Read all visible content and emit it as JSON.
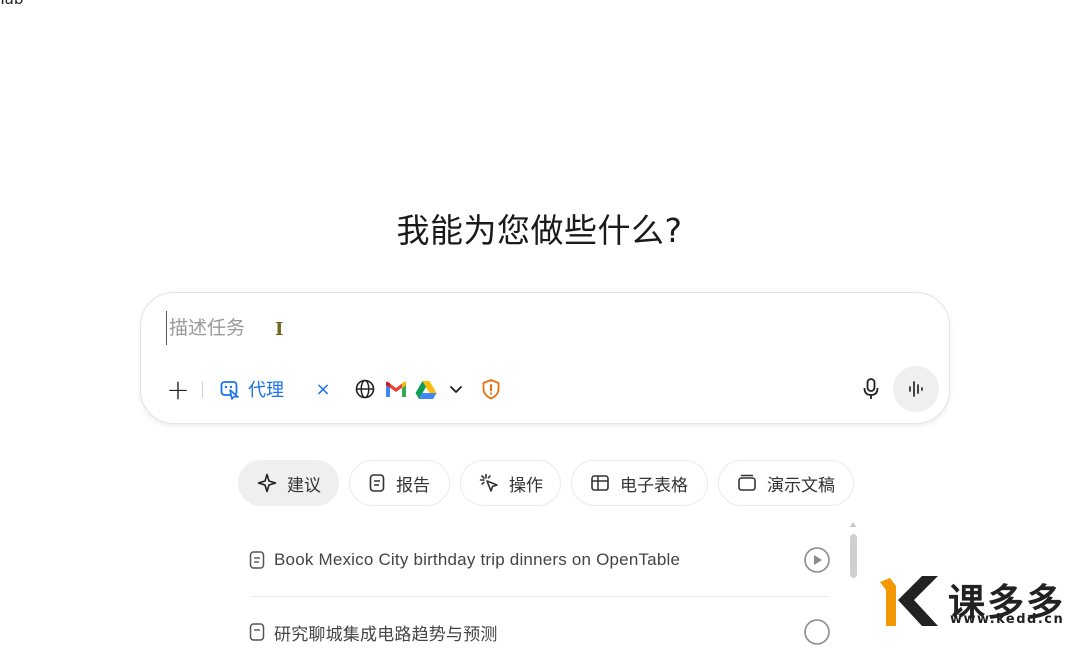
{
  "corner_text": "Tab",
  "heading": "我能为您做些什么?",
  "composer": {
    "placeholder": "描述任务",
    "agent_label": "代理",
    "agent_remove": "×",
    "plus": "+"
  },
  "tabs": [
    {
      "label": "建议",
      "icon": "sparkle-icon",
      "active": true
    },
    {
      "label": "报告",
      "icon": "report-icon"
    },
    {
      "label": "操作",
      "icon": "action-icon"
    },
    {
      "label": "电子表格",
      "icon": "table-icon"
    },
    {
      "label": "演示文稿",
      "icon": "slides-icon"
    }
  ],
  "suggestions": [
    {
      "label": "Book Mexico City birthday trip dinners on OpenTable"
    },
    {
      "label": "研究聊城集成电路趋势与预测"
    }
  ],
  "watermark": {
    "name": "课多多",
    "url": "www.kedd.cn"
  },
  "colors": {
    "accent": "#1a73e8",
    "shield": "#e8710a",
    "logo_orange": "#f39800"
  }
}
